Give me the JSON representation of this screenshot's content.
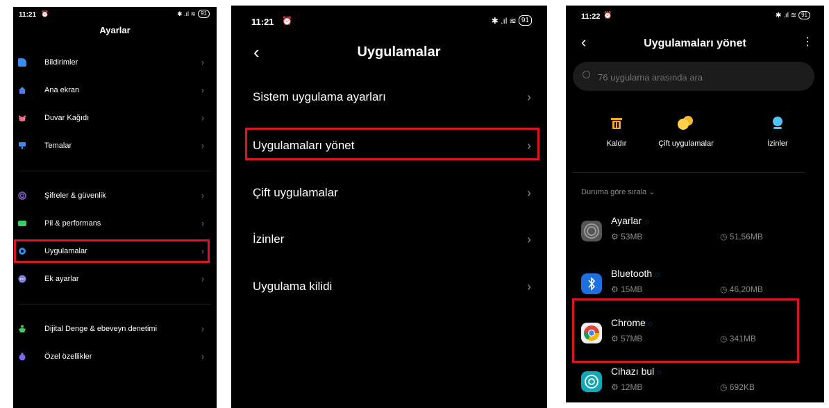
{
  "panel1": {
    "time": "11:21",
    "alarm": "⏰",
    "signal": "✱ .ıl ≋",
    "battery": "91",
    "title": "Ayarlar",
    "items": [
      {
        "label": "Bildirimler",
        "icon": "notification-icon",
        "color": "#3b8cf0"
      },
      {
        "label": "Ana ekran",
        "icon": "home-icon",
        "color": "#3b8cf0"
      },
      {
        "label": "Duvar Kağıdı",
        "icon": "wallpaper-icon",
        "color": "#f06e8a"
      },
      {
        "label": "Temalar",
        "icon": "theme-icon",
        "color": "#3b8cf0"
      },
      {
        "label": "Şifreler & güvenlik",
        "icon": "password-icon",
        "color": "#8a63d2"
      },
      {
        "label": "Pil & performans",
        "icon": "battery-icon",
        "color": "#2fd06a"
      },
      {
        "label": "Uygulamalar",
        "icon": "gear-icon",
        "color": "#2a93f0"
      },
      {
        "label": "Ek ayarlar",
        "icon": "more-icon",
        "color": "#7a7ee8"
      },
      {
        "label": "Dijital Denge & ebeveyn denetimi",
        "icon": "wellbeing-icon",
        "color": "#3fd05a"
      },
      {
        "label": "Özel özellikler",
        "icon": "special-features-icon",
        "color": "#7a6cf0"
      }
    ],
    "chevron": "›"
  },
  "panel2": {
    "time": "11:21",
    "alarm": "⏰",
    "signal": "✱ .ıl ≋",
    "battery": "91",
    "back": "‹",
    "title": "Uygulamalar",
    "items": [
      {
        "label": "Sistem uygulama ayarları"
      },
      {
        "label": "Uygulamaları yönet"
      },
      {
        "label": "Çift uygulamalar"
      },
      {
        "label": "İzinler"
      },
      {
        "label": "Uygulama kilidi"
      }
    ],
    "chevron": "›"
  },
  "panel3": {
    "time": "11:22",
    "alarm": "⏰",
    "signal": "✱ .ıl ≋",
    "battery": "91",
    "back": "‹",
    "title": "Uygulamaları yönet",
    "more": "⋮",
    "search_placeholder": "76 uygulama arasında ara",
    "actions": [
      {
        "label": "Kaldır",
        "icon": "trash-icon",
        "color": "#f5a623"
      },
      {
        "label": "Çift uygulamalar",
        "icon": "dual-apps-icon",
        "color": "#f5b82e"
      },
      {
        "label": "İzinler",
        "icon": "permissions-icon",
        "color": "#4fc3f7"
      }
    ],
    "sort_label": "Duruma göre sırala ⌄",
    "apps": [
      {
        "name": "Ayarlar",
        "size": "⚙ 53MB",
        "data": "◷ 51,56MB",
        "icon": "settings-app-icon"
      },
      {
        "name": "Bluetooth",
        "size": "⚙ 15MB",
        "data": "◷ 46,20MB",
        "icon": "bluetooth-app-icon"
      },
      {
        "name": "Chrome",
        "size": "⚙ 57MB",
        "data": "◷ 341MB",
        "icon": "chrome-app-icon"
      },
      {
        "name": "Cihazı bul",
        "size": "⚙ 12MB",
        "data": "◷ 692KB",
        "icon": "find-device-app-icon"
      }
    ],
    "spin": "◌"
  },
  "colors": {
    "highlight": "#e0141e",
    "background": "#000000"
  }
}
